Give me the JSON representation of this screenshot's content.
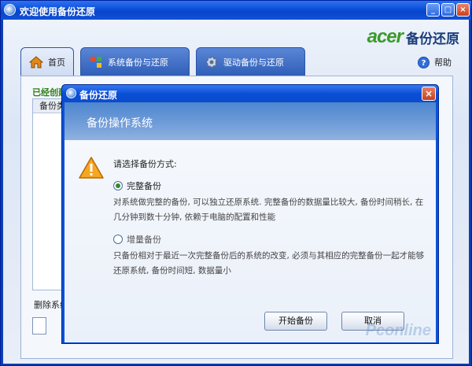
{
  "window": {
    "title": "欢迎使用备份还原",
    "minimize": "_",
    "maximize": "□",
    "close": "×"
  },
  "brand": {
    "logo": "acer",
    "product": "备份还原"
  },
  "tabs": [
    {
      "label": "首页",
      "icon": "home-icon"
    },
    {
      "label": "系统备份与还原",
      "icon": "windows-icon"
    },
    {
      "label": "驱动备份与还原",
      "icon": "gear-icon"
    }
  ],
  "help": {
    "label": "帮助",
    "glyph": "?"
  },
  "panel": {
    "created_label": "已经创建",
    "list_header": "备份类",
    "delete_label": "删除系统"
  },
  "dialog": {
    "title": "备份还原",
    "close": "×",
    "header": "备份操作系统",
    "prompt": "请选择备份方式:",
    "options": [
      {
        "label": "完整备份",
        "selected": true,
        "description": "对系统做完整的备份, 可以独立还原系统. 完整备份的数据量比较大, 备份时间稍长, 在几分钟到数十分钟, 依赖于电脑的配置和性能"
      },
      {
        "label": "增量备份",
        "selected": false,
        "description": "只备份相对于最近一次完整备份后的系统的改变, 必须与其相应的完整备份一起才能够还原系统, 备份时间短, 数据量小"
      }
    ],
    "start_button": "开始备份",
    "cancel_button": "取消"
  },
  "watermark": "Pconline",
  "colors": {
    "titlebar": "#0a4fd8",
    "accent_green": "#3a9a2a",
    "dialog_header": "#5b8fd2"
  }
}
